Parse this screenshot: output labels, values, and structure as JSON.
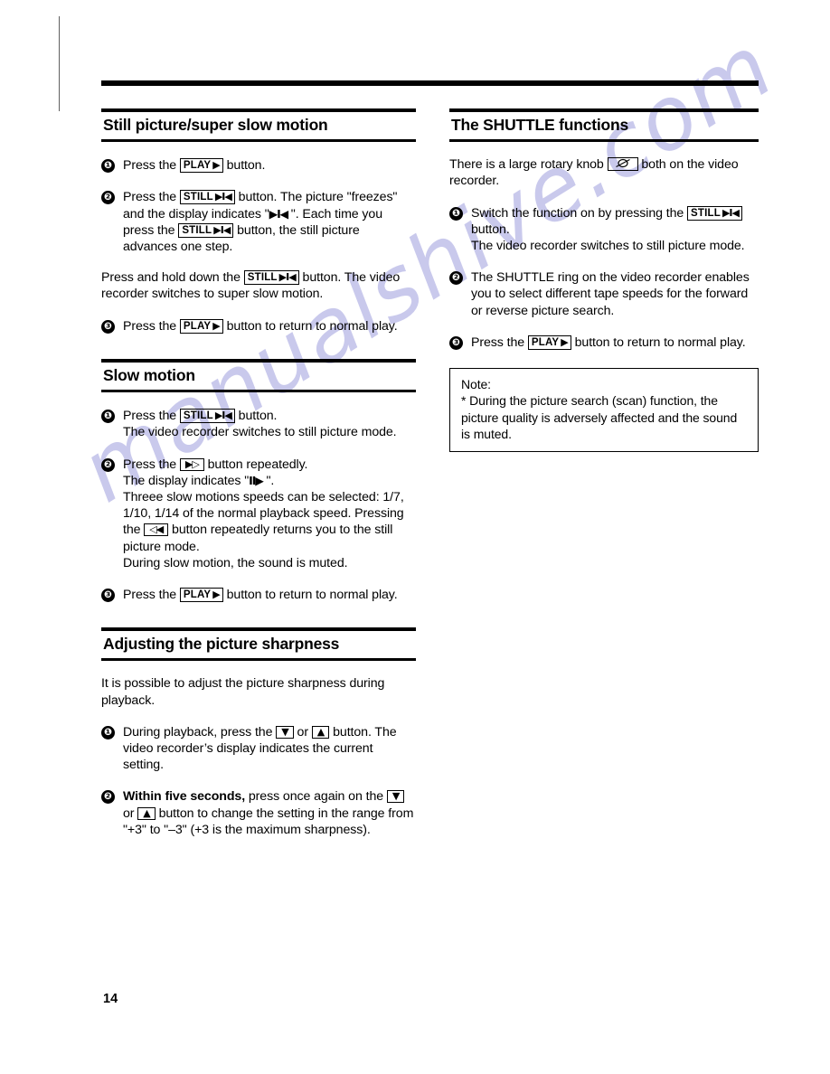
{
  "page": {
    "number": "14",
    "watermark": "manualshive.com"
  },
  "left_column": {
    "sections": [
      {
        "title": "Still picture/super slow motion",
        "steps": [
          {
            "num": "❶",
            "segments": [
              {
                "t": "text",
                "v": "Press the "
              },
              {
                "t": "button",
                "label": "PLAY",
                "glyph": "▶"
              },
              {
                "t": "text",
                "v": " button."
              }
            ]
          },
          {
            "num": "❷",
            "segments": [
              {
                "t": "text",
                "v": "Press the "
              },
              {
                "t": "button",
                "label": "STILL",
                "glyph": "▶I◀"
              },
              {
                "t": "text",
                "v": " button. The picture \"freezes\" and the display indicates \""
              },
              {
                "t": "glyph",
                "v": "▶I◀"
              },
              {
                "t": "text",
                "v": " \". Each time you press the "
              },
              {
                "t": "button",
                "label": "STILL",
                "glyph": "▶I◀"
              },
              {
                "t": "text",
                "v": " button, the still picture advances one step."
              }
            ]
          }
        ],
        "paragraph": [
          {
            "t": "text",
            "v": "Press and hold down the "
          },
          {
            "t": "button",
            "label": "STILL",
            "glyph": "▶I◀"
          },
          {
            "t": "text",
            "v": " button. The video recorder switches to super slow motion."
          }
        ],
        "final_step": {
          "num": "❸",
          "segments": [
            {
              "t": "text",
              "v": "Press the "
            },
            {
              "t": "button",
              "label": "PLAY",
              "glyph": "▶"
            },
            {
              "t": "text",
              "v": " button to return to normal play."
            }
          ]
        }
      },
      {
        "title": "Slow motion",
        "steps": [
          {
            "num": "❶",
            "segments": [
              {
                "t": "text",
                "v": "Press the "
              },
              {
                "t": "button",
                "label": "STILL",
                "glyph": "▶I◀"
              },
              {
                "t": "text",
                "v": " button."
              },
              {
                "t": "break"
              },
              {
                "t": "text",
                "v": "The video recorder switches to still picture mode."
              }
            ]
          },
          {
            "num": "❷",
            "segments": [
              {
                "t": "text",
                "v": "Press the "
              },
              {
                "t": "button",
                "label": "",
                "glyph": "▶▷"
              },
              {
                "t": "text",
                "v": " button repeatedly."
              },
              {
                "t": "break"
              },
              {
                "t": "text",
                "v": "The display indicates \""
              },
              {
                "t": "glyph",
                "v": "Ⅱ▶"
              },
              {
                "t": "text",
                "v": " \"."
              },
              {
                "t": "break"
              },
              {
                "t": "text",
                "v": "Threee slow motions speeds can be selected: 1/7, 1/10, 1/14 of the normal playback speed. Pressing the "
              },
              {
                "t": "button",
                "label": "",
                "glyph": "◁◀"
              },
              {
                "t": "text",
                "v": " button repeatedly returns you to the still picture mode."
              },
              {
                "t": "break"
              },
              {
                "t": "text",
                "v": "During slow motion, the sound is muted."
              }
            ]
          }
        ],
        "final_step": {
          "num": "❸",
          "segments": [
            {
              "t": "text",
              "v": "Press the "
            },
            {
              "t": "button",
              "label": "PLAY",
              "glyph": "▶"
            },
            {
              "t": "text",
              "v": " button to return to normal play."
            }
          ]
        }
      },
      {
        "title": "Adjusting the picture sharpness",
        "intro": "It is possible to adjust the picture sharpness during playback.",
        "steps": [
          {
            "num": "❶",
            "segments": [
              {
                "t": "text",
                "v": "During playback, press the "
              },
              {
                "t": "button",
                "label": "",
                "glyph": "▼"
              },
              {
                "t": "text",
                "v": " or "
              },
              {
                "t": "button",
                "label": "",
                "glyph": "▲"
              },
              {
                "t": "text",
                "v": " button. The video recorder’s display indicates the current setting."
              }
            ]
          },
          {
            "num": "❷",
            "segments": [
              {
                "t": "bold",
                "v": "Within five seconds,"
              },
              {
                "t": "text",
                "v": " press once again on the "
              },
              {
                "t": "button",
                "label": "",
                "glyph": "▼"
              },
              {
                "t": "text",
                "v": " or "
              },
              {
                "t": "button",
                "label": "",
                "glyph": "▲"
              },
              {
                "t": "text",
                "v": " button to change the setting in the range from \"+3\" to \"–3\" (+3 is the maximum sharpness)."
              }
            ]
          }
        ]
      }
    ]
  },
  "right_column": {
    "section": {
      "title": "The SHUTTLE functions",
      "intro": [
        {
          "t": "text",
          "v": "There is a large rotary knob "
        },
        {
          "t": "knob"
        },
        {
          "t": "text",
          "v": " both on the video recorder."
        }
      ],
      "steps": [
        {
          "num": "❶",
          "segments": [
            {
              "t": "text",
              "v": "Switch the function on by pressing the "
            },
            {
              "t": "button",
              "label": "STILL",
              "glyph": "▶I◀"
            },
            {
              "t": "text",
              "v": " button."
            },
            {
              "t": "break"
            },
            {
              "t": "text",
              "v": "The video recorder switches to still picture mode."
            }
          ]
        },
        {
          "num": "❷",
          "segments": [
            {
              "t": "text",
              "v": "The SHUTTLE ring on the video recorder enables you to select different tape speeds for the forward or reverse picture search."
            }
          ]
        },
        {
          "num": "❸",
          "segments": [
            {
              "t": "text",
              "v": "Press the "
            },
            {
              "t": "button",
              "label": "PLAY",
              "glyph": "▶"
            },
            {
              "t": "text",
              "v": " button to return to normal play."
            }
          ]
        }
      ],
      "note": {
        "heading": "Note:",
        "body": "* During the picture search (scan) function, the picture quality is adversely affected and the sound is muted."
      }
    }
  }
}
